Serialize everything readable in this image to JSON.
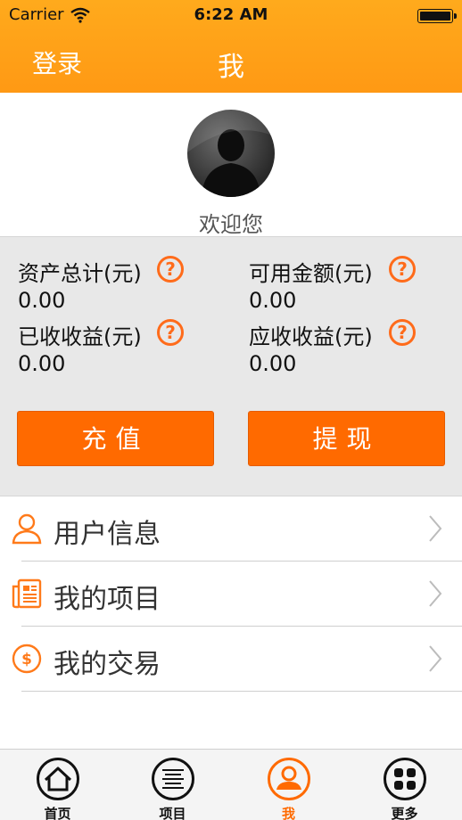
{
  "status_bar": {
    "carrier": "Carrier",
    "time": "6:22 AM"
  },
  "nav": {
    "left_button": "登录",
    "title": "我"
  },
  "profile": {
    "welcome": "欢迎您"
  },
  "stats": {
    "total_assets_label": "资产总计(元)",
    "total_assets_value": "0.00",
    "available_label": "可用金额(元)",
    "available_value": "0.00",
    "received_label": "已收收益(元)",
    "received_value": "0.00",
    "receivable_label": "应收收益(元)",
    "receivable_value": "0.00",
    "help_glyph": "?"
  },
  "actions": {
    "recharge": "充值",
    "withdraw": "提现"
  },
  "menu": [
    {
      "label": "用户信息",
      "icon": "user-icon"
    },
    {
      "label": "我的项目",
      "icon": "document-icon"
    },
    {
      "label": "我的交易",
      "icon": "dollar-icon"
    }
  ],
  "tabs": [
    {
      "label": "首页",
      "icon": "home-icon"
    },
    {
      "label": "项目",
      "icon": "list-icon"
    },
    {
      "label": "我",
      "icon": "person-icon",
      "active": true
    },
    {
      "label": "更多",
      "icon": "grid-icon"
    }
  ],
  "colors": {
    "header": "#ffa01a",
    "accent": "#ff6a00",
    "panel": "#e8e8e8"
  }
}
